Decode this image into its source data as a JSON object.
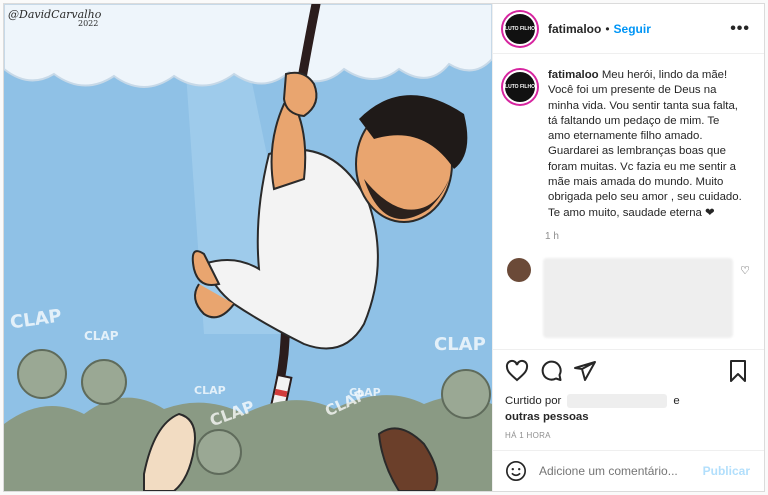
{
  "post": {
    "username": "fatimaloo",
    "follow_label": "Seguir",
    "avatar_text": "LUTO FILHO",
    "more_label": "•••",
    "caption_text": "Meu herói, lindo da mãe! Você foi um presente de Deus na minha vida. Vou sentir tanta sua falta, tá faltando um pedaço de mim. Te amo eternamente filho amado. Guardarei as lembranças boas que foram muitas. Vc fazia eu me sentir a mãe mais amada do mundo. Muito obrigada pelo seu amor , seu cuidado. Te amo muito, saudade eterna ❤",
    "caption_time": "1 h",
    "likes_prefix": "Curtido por",
    "likes_conj": "e",
    "likes_others": "outras pessoas",
    "posted_ago": "HÁ 1 HORA",
    "add_comment_placeholder": "Adicione um comentário...",
    "publish_label": "Publicar"
  },
  "image": {
    "signature": "@DavidCarvalho",
    "signature_year": "2022",
    "clap_words": [
      "CLAP",
      "CLAP",
      "CLAP",
      "CLAP",
      "CLAP",
      "CLAP",
      "CLAP"
    ]
  },
  "icons": [
    "heart-icon",
    "comment-icon",
    "share-icon",
    "bookmark-icon",
    "emoji-icon",
    "more-icon"
  ],
  "colors": {
    "link": "#0095f6",
    "publish_disabled": "#b2dffc",
    "sky": "#8fc1e6"
  }
}
